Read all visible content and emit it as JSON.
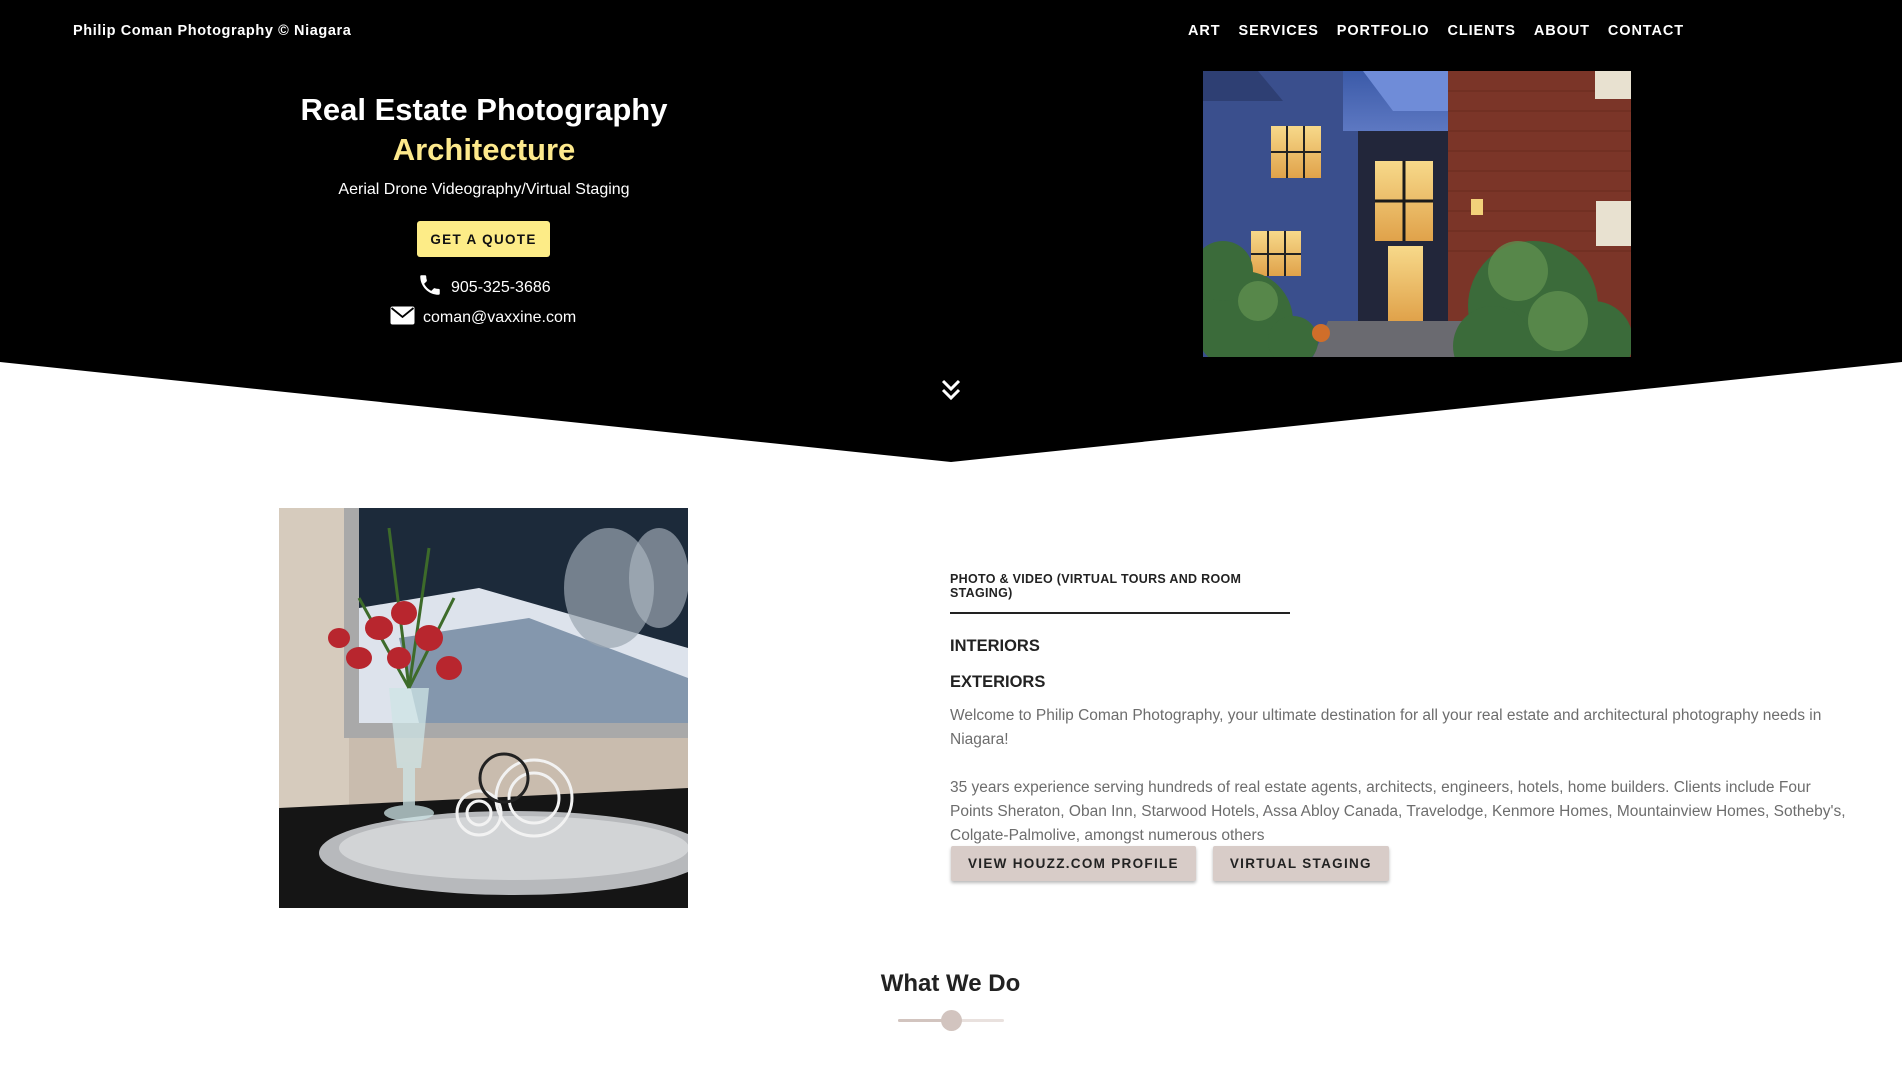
{
  "header": {
    "brand": "Philip Coman Photography © Niagara",
    "nav": [
      "ART",
      "SERVICES",
      "PORTFOLIO",
      "CLIENTS",
      "ABOUT",
      "CONTACT"
    ]
  },
  "hero": {
    "title": "Real Estate Photography",
    "title_accent": "Architecture",
    "subtitle": "Aerial Drone Videography/Virtual Staging",
    "quote_button": "GET A QUOTE",
    "phone": "905-325-3686",
    "email": "coman@vaxxine.com",
    "accent_color": "#fde98c"
  },
  "intro": {
    "kicker": "PHOTO & VIDEO (VIRTUAL TOURS AND ROOM STAGING)",
    "heading_1": "INTERIORS",
    "heading_2": "EXTERIORS",
    "paragraph_1": "Welcome to Philip Coman Photography, your ultimate destination for all your real estate and architectural photography needs in Niagara!",
    "paragraph_2": "35 years experience serving hundreds of real estate agents, architects, engineers, hotels, home builders. Clients include Four Points Sheraton, Oban Inn, Starwood Hotels, Assa Abloy Canada, Travelodge, Kenmore Homes, Mountainview Homes, Sotheby's, Colgate-Palmolive, amongst numerous others",
    "button_houzz": "VIEW HOUZZ.COM PROFILE",
    "button_staging": "VIRTUAL STAGING"
  },
  "what_we_do": {
    "title": "What We Do",
    "slider_fraction": 0.5
  },
  "icons": {
    "phone": "phone-icon",
    "email": "envelope-icon",
    "scroll": "double-chevron-down-icon"
  }
}
